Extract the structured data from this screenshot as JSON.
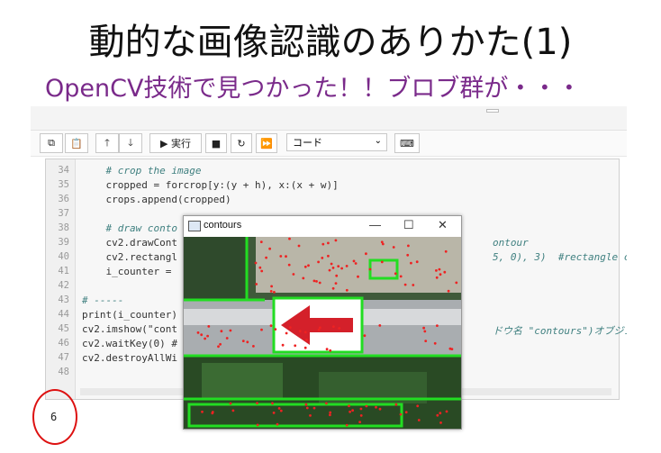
{
  "slide": {
    "title": "動的な画像認識のありかた(1)",
    "subtitle": "OpenCV技術で見つかった！！ブロブ群が・・・",
    "title_color": "#111111",
    "subtitle_color": "#7a2a8a"
  },
  "notebook": {
    "toolbar": {
      "run_label": "▶ 実行",
      "cell_type": "コード"
    },
    "code": [
      {
        "n": "34",
        "text": "    # crop the image",
        "comment": true
      },
      {
        "n": "35",
        "text": "    cropped = forcrop[y:(y + h), x:(x + w)]",
        "comment": false
      },
      {
        "n": "36",
        "text": "    crops.append(cropped)",
        "comment": false
      },
      {
        "n": "37",
        "text": "",
        "comment": false
      },
      {
        "n": "38",
        "text": "    # draw conto",
        "comment": true
      },
      {
        "n": "39",
        "text": "    cv2.drawCont",
        "comment": false
      },
      {
        "n": "40",
        "text": "    cv2.rectangl",
        "comment": false
      },
      {
        "n": "41",
        "text": "    i_counter =",
        "comment": false
      },
      {
        "n": "42",
        "text": "",
        "comment": false
      },
      {
        "n": "43",
        "text": "# -----",
        "comment": true
      },
      {
        "n": "44",
        "text": "print(i_counter)",
        "comment": false
      },
      {
        "n": "45",
        "text": "cv2.imshow(\"cont",
        "comment": false
      },
      {
        "n": "46",
        "text": "cv2.waitKey(0) #",
        "comment": false
      },
      {
        "n": "47",
        "text": "cv2.destroyAllWi",
        "comment": false
      },
      {
        "n": "48",
        "text": "",
        "comment": false
      }
    ],
    "code_right": [
      {
        "n": "39",
        "text": "ontour",
        "comment": true
      },
      {
        "n": "40",
        "text": "5, 0), 3)  #rectangle cor",
        "comment": true
      },
      {
        "n": "45",
        "text": "ドウ名 \"contours\")オブジェ",
        "comment": true
      }
    ],
    "output": "6",
    "highlight_color": "#dd1111"
  },
  "window": {
    "title": "contours",
    "minimize": "—",
    "maximize": "☐",
    "close": "✕"
  }
}
